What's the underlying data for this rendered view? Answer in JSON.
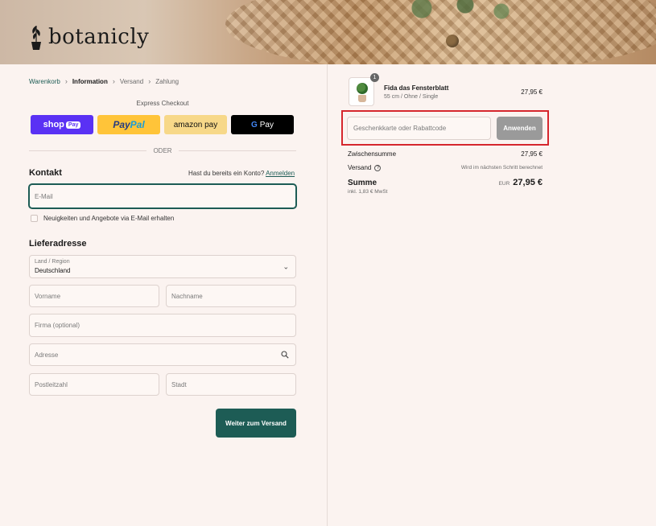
{
  "header": {
    "logo_text": "botanicly"
  },
  "breadcrumb": {
    "items": [
      "Warenkorb",
      "Information",
      "Versand",
      "Zahlung"
    ]
  },
  "express": {
    "label": "Express Checkout",
    "shop_label": "shop",
    "shop_pay": "Pay",
    "paypal_pay": "Pay",
    "paypal_pal": "Pal",
    "amazon_label": "amazon pay",
    "gpay_g": "G",
    "gpay_label": "Pay"
  },
  "divider_label": "ODER",
  "contact": {
    "title": "Kontakt",
    "login_hint": "Hast du bereits ein Konto?",
    "login_link": "Anmelden",
    "email_placeholder": "E-Mail",
    "newsletter_label": "Neuigkeiten und Angebote via E-Mail erhalten"
  },
  "shipping": {
    "title": "Lieferadresse",
    "country_label": "Land / Region",
    "country_value": "Deutschland",
    "first_name": "Vorname",
    "last_name": "Nachname",
    "company": "Firma (optional)",
    "address": "Adresse",
    "zip": "Postleitzahl",
    "city": "Stadt",
    "continue_label": "Weiter zum Versand"
  },
  "summary": {
    "quantity": "1",
    "product_name": "Fida das Fensterblatt",
    "product_variant": "55 cm / Ohne / Single",
    "product_price": "27,95 €",
    "discount_placeholder": "Geschenkkarte oder Rabattcode",
    "apply_label": "Anwenden",
    "subtotal_label": "Zwischensumme",
    "subtotal_value": "27,95 €",
    "shipping_label": "Versand",
    "shipping_note": "Wird im nächsten Schritt berechnet",
    "total_label": "Summe",
    "total_currency": "EUR",
    "total_value": "27,95 €",
    "tax_note": "inkl. 1,83 € MwSt"
  },
  "colors": {
    "accent": "#1d5c55",
    "background": "#fbf3f0",
    "highlight": "#d6262d"
  }
}
